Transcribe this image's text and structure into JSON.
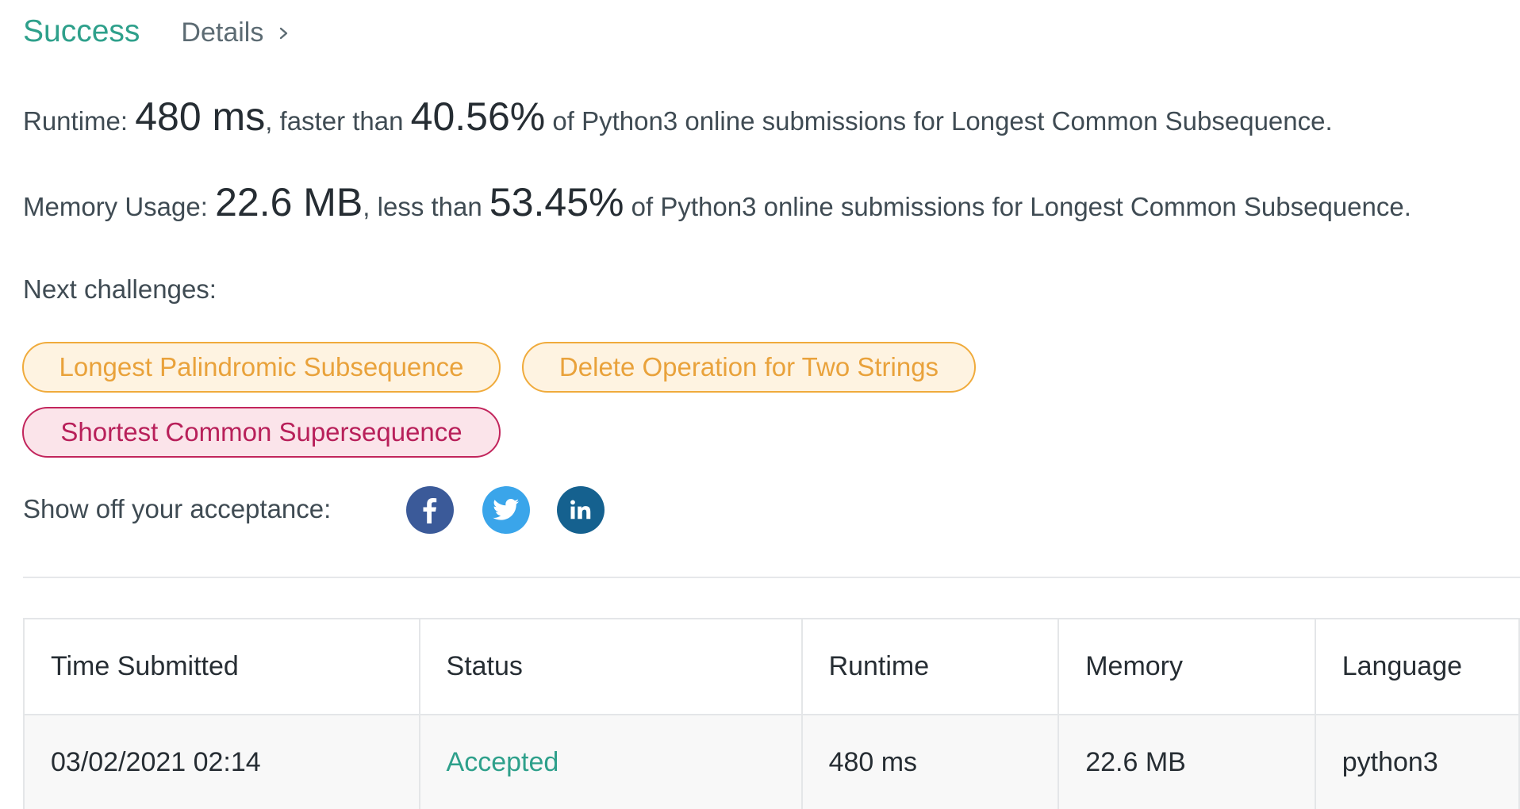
{
  "header": {
    "status": "Success",
    "details_label": "Details"
  },
  "runtime": {
    "label": "Runtime:",
    "value": "480 ms",
    "comparison": ", faster than",
    "percent": "40.56%",
    "suffix": "of Python3 online submissions for Longest Common Subsequence."
  },
  "memory": {
    "label": "Memory Usage:",
    "value": "22.6 MB",
    "comparison": ", less than",
    "percent": "53.45%",
    "suffix": "of Python3 online submissions for Longest Common Subsequence."
  },
  "next_challenges": {
    "label": "Next challenges:",
    "items": [
      {
        "title": "Longest Palindromic Subsequence",
        "difficulty": "medium"
      },
      {
        "title": "Delete Operation for Two Strings",
        "difficulty": "medium"
      },
      {
        "title": "Shortest Common Supersequence",
        "difficulty": "hard"
      }
    ]
  },
  "share": {
    "label": "Show off your acceptance:",
    "icons": [
      "facebook-icon",
      "twitter-icon",
      "linkedin-icon"
    ]
  },
  "colors": {
    "success": "#2ea08b",
    "medium": "#f0ab3c",
    "hard": "#c2255c",
    "facebook": "#3b5a99",
    "twitter": "#3aa5ea",
    "linkedin": "#15618f"
  },
  "table": {
    "headers": [
      "Time Submitted",
      "Status",
      "Runtime",
      "Memory",
      "Language"
    ],
    "rows": [
      {
        "time": "03/02/2021 02:14",
        "status": "Accepted",
        "runtime": "480 ms",
        "memory": "22.6 MB",
        "language": "python3"
      }
    ]
  }
}
